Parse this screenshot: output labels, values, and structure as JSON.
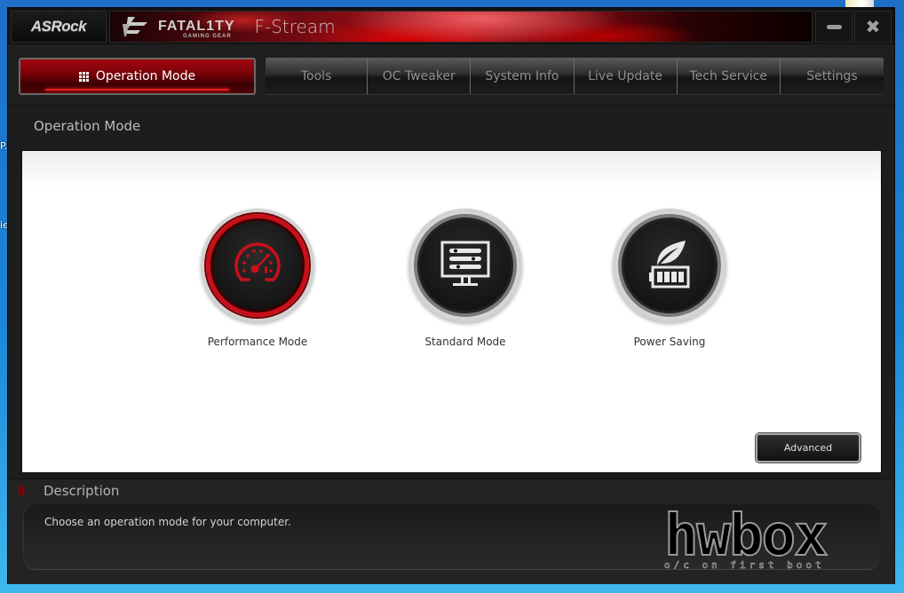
{
  "desktop": {
    "fragments": [
      "P.",
      "ie"
    ]
  },
  "window": {
    "brand": "ASRock",
    "banner_logo": "FATAL1TY",
    "banner_logo_sub": "GAMING GEAR",
    "app_title": "F-Stream",
    "minimize_icon": "minimize-icon",
    "close_icon": "close-icon"
  },
  "nav": {
    "active": {
      "label": "Operation Mode",
      "icon": "grid-icon"
    },
    "tabs": [
      {
        "label": "Tools"
      },
      {
        "label": "OC Tweaker"
      },
      {
        "label": "System Info"
      },
      {
        "label": "Live Update"
      },
      {
        "label": "Tech Service"
      },
      {
        "label": "Settings"
      }
    ]
  },
  "main": {
    "section_title": "Operation Mode",
    "modes": [
      {
        "label": "Performance Mode",
        "icon": "speedometer-icon",
        "selected": true
      },
      {
        "label": "Standard Mode",
        "icon": "monitor-icon",
        "selected": false
      },
      {
        "label": "Power Saving",
        "icon": "leaf-battery-icon",
        "selected": false
      }
    ],
    "advanced_label": "Advanced"
  },
  "description": {
    "title": "Description",
    "text": "Choose an operation mode for your computer."
  },
  "watermark": {
    "main": "hwbox",
    "sub": "o/c on first boot"
  },
  "colors": {
    "accent": "#c8101a",
    "window_bg": "#1d1d1d",
    "content_bg": "#ffffff"
  }
}
